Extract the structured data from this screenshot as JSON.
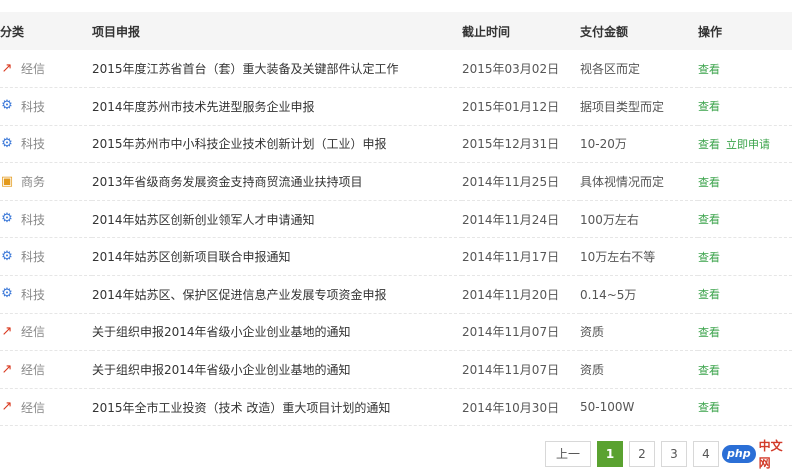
{
  "header": {
    "category": "分类",
    "project": "项目申报",
    "deadline": "截止时间",
    "payment": "支付金额",
    "action": "操作"
  },
  "category_icons": {
    "经信": "line-chart-icon",
    "科技": "gear-icon",
    "商务": "briefcase-icon"
  },
  "colors": {
    "link_green": "#3aa34a",
    "active_page": "#5aa230",
    "jingxin_icon": "#d9381e",
    "keji_icon": "#3b78d8",
    "shangwu_icon": "#e39a1c"
  },
  "rows": [
    {
      "category": "经信",
      "icon": "line-chart-icon",
      "title": "2015年度江苏省首台（套）重大装备及关键部件认定工作",
      "deadline": "2015年03月02日",
      "payment": "视各区而定",
      "view": "查看",
      "apply": ""
    },
    {
      "category": "科技",
      "icon": "gear-icon",
      "title": "2014年度苏州市技术先进型服务企业申报",
      "deadline": "2015年01月12日",
      "payment": "据项目类型而定",
      "view": "查看",
      "apply": ""
    },
    {
      "category": "科技",
      "icon": "gear-icon",
      "title": "2015年苏州市中小科技企业技术创新计划（工业）申报",
      "deadline": "2015年12月31日",
      "payment": "10-20万",
      "view": "查看",
      "apply": "立即申请"
    },
    {
      "category": "商务",
      "icon": "briefcase-icon",
      "title": "2013年省级商务发展资金支持商贸流通业扶持项目",
      "deadline": "2014年11月25日",
      "payment": "具体视情况而定",
      "view": "查看",
      "apply": ""
    },
    {
      "category": "科技",
      "icon": "gear-icon",
      "title": "2014年姑苏区创新创业领军人才申请通知",
      "deadline": "2014年11月24日",
      "payment": "100万左右",
      "view": "查看",
      "apply": ""
    },
    {
      "category": "科技",
      "icon": "gear-icon",
      "title": "2014年姑苏区创新项目联合申报通知",
      "deadline": "2014年11月17日",
      "payment": "10万左右不等",
      "view": "查看",
      "apply": ""
    },
    {
      "category": "科技",
      "icon": "gear-icon",
      "title": "2014年姑苏区、保护区促进信息产业发展专项资金申报",
      "deadline": "2014年11月20日",
      "payment": "0.14~5万",
      "view": "查看",
      "apply": ""
    },
    {
      "category": "经信",
      "icon": "line-chart-icon",
      "title": "关于组织申报2014年省级小企业创业基地的通知",
      "deadline": "2014年11月07日",
      "payment": "资质",
      "view": "查看",
      "apply": ""
    },
    {
      "category": "经信",
      "icon": "line-chart-icon",
      "title": "关于组织申报2014年省级小企业创业基地的通知",
      "deadline": "2014年11月07日",
      "payment": "资质",
      "view": "查看",
      "apply": ""
    },
    {
      "category": "经信",
      "icon": "line-chart-icon",
      "title": "2015年全市工业投资（技术 改造）重大项目计划的通知",
      "deadline": "2014年10月30日",
      "payment": "50-100W",
      "view": "查看",
      "apply": ""
    }
  ],
  "pagination": {
    "prev": "上一页",
    "pages": [
      "1",
      "2",
      "3",
      "4"
    ],
    "active": "1"
  },
  "watermark": {
    "badge": "php",
    "text": "中文网"
  }
}
